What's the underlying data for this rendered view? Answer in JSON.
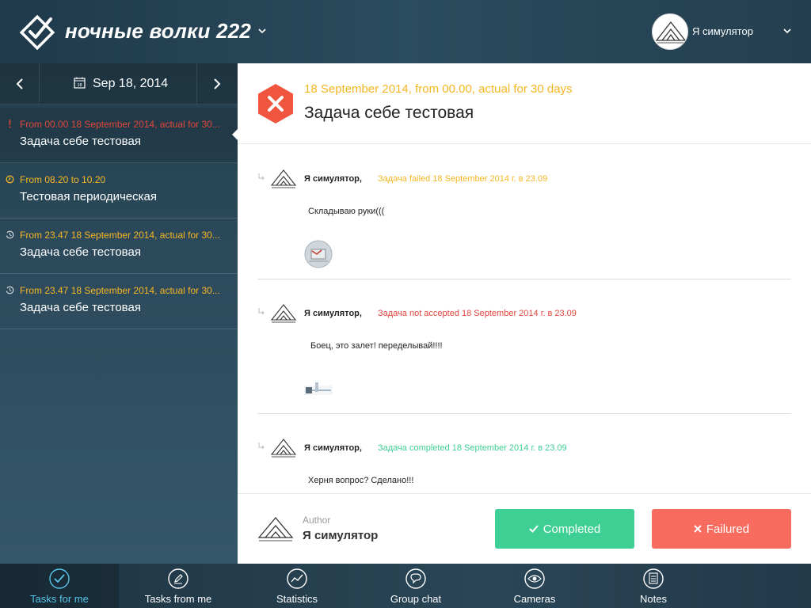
{
  "header": {
    "app_title": "ночные волки 222",
    "user_name": "Я симулятор"
  },
  "sidebar": {
    "date_label": "Sep 18, 2014",
    "calendar_day": "18",
    "tasks": [
      {
        "time": "From 00.00 18 September 2014, actual for 30...",
        "title": "Задача себе тестовая",
        "state": "failed"
      },
      {
        "time": "From 08.20 to 10.20",
        "title": "Тестовая периодическая",
        "state": "periodic"
      },
      {
        "time": "From 23.47 18 September 2014, actual for 30...",
        "title": "Задача себе тестовая",
        "state": "scheduled"
      },
      {
        "time": "From 23.47 18 September 2014, actual for 30...",
        "title": "Задача себе тестовая",
        "state": "scheduled"
      }
    ]
  },
  "task": {
    "time": "18 September 2014, from 00.00, actual for 30 days",
    "title": "Задача себе тестовая"
  },
  "comments": [
    {
      "author": "Я симулятор,",
      "status": "Задача failed 18 September 2014 г. в 23.09",
      "status_color": "#f5b623",
      "text": "Складываю руки(((",
      "attachment": "photo"
    },
    {
      "author": "Я симулятор,",
      "status": "Задача not accepted 18 September 2014 г. в 23.09",
      "status_color": "#e2463a",
      "text": "Боец, это залет! переделывай!!!!",
      "attachment": "image"
    },
    {
      "author": "Я симулятор,",
      "status": "Задача completed 18 September 2014 г. в 23.09",
      "status_color": "#3ecf95",
      "text": "Херня вопрос? Сделано!!!",
      "attachment": "none"
    }
  ],
  "author": {
    "caption": "Author",
    "name": "Я симулятор"
  },
  "actions": {
    "completed_label": "Completed",
    "failed_label": "Failured"
  },
  "tabs": [
    {
      "label": "Tasks for me",
      "icon": "check-circle-icon",
      "active": true
    },
    {
      "label": "Tasks from me",
      "icon": "pen-circle-icon",
      "active": false
    },
    {
      "label": "Statistics",
      "icon": "chart-circle-icon",
      "active": false
    },
    {
      "label": "Group chat",
      "icon": "chat-circle-icon",
      "active": false
    },
    {
      "label": "Cameras",
      "icon": "eye-circle-icon",
      "active": false
    },
    {
      "label": "Notes",
      "icon": "notes-circle-icon",
      "active": false
    }
  ],
  "colors": {
    "accent_orange": "#f5b623",
    "accent_red": "#e2463a",
    "accent_green": "#3ecf95",
    "button_fail": "#f86b5f",
    "tab_active": "#56c4e8"
  }
}
